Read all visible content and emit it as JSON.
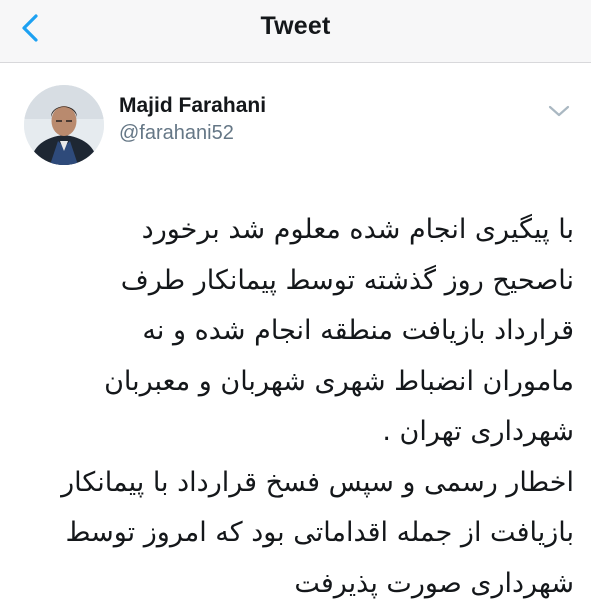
{
  "nav": {
    "title": "Tweet",
    "back_icon": "chevron-left-icon",
    "accent_color": "#1da1f2"
  },
  "tweet": {
    "author": {
      "display_name": "Majid Farahani",
      "handle": "@farahani52"
    },
    "menu_icon": "chevron-down-icon",
    "text_lines": [
      "با پیگیری انجام شده معلوم شد برخورد",
      "ناصحیح روز گذشته توسط پیمانکار طرف",
      "قرارداد بازیافت منطقه انجام شده و نه",
      "ماموران انضباط شهری شهربان و معبربان",
      "شهرداری تهران .",
      "اخطار رسمی و سپس فسخ قرارداد با پیمانکار",
      "بازیافت از جمله اقداماتی بود که امروز توسط",
      "شهرداری صورت پذیرفت"
    ]
  }
}
